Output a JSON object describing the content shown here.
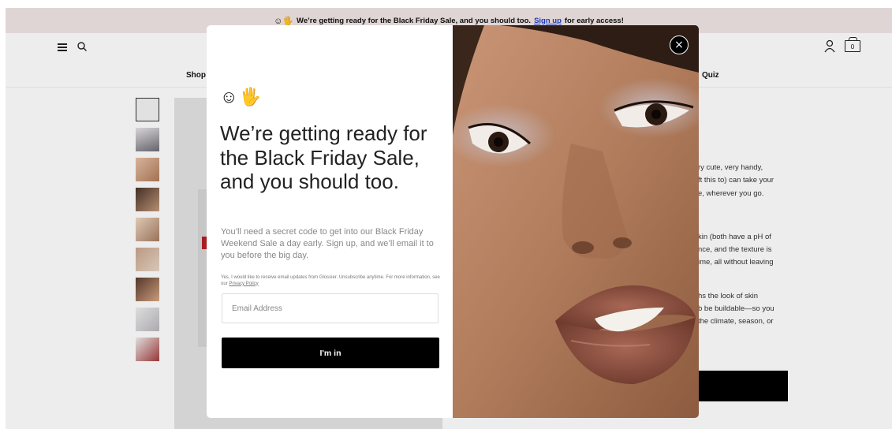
{
  "announcement": {
    "emoji": "☺🖐",
    "text": "We’re getting ready for the Black Friday Sale, and you should too.",
    "link": "Sign up",
    "after": "for early access!"
  },
  "header": {
    "menu_icon": "hamburger-icon",
    "search_icon": "search-icon",
    "account_icon": "user-icon",
    "bag_icon": "bag-icon",
    "bag_count": "0"
  },
  "nav": {
    "shop": "Shop",
    "quiz": "Quiz"
  },
  "product_description": [
    "ry cute, very handy,",
    "ft this to) can take your",
    "e, wherever you go.",
    "kin (both have a pH of",
    "nce, and the texture is",
    "ime, all without leaving",
    "hs the look of skin",
    "b be buildable—so you",
    "the climate, season, or"
  ],
  "modal": {
    "emoji": "☺🖐",
    "title": "We’re getting ready for the Black Friday Sale, and you should too.",
    "subtitle": "You’ll need a secret code to get into our Black Friday Weekend Sale a day early. Sign up, and we’ll email it to you before the big day.",
    "legal": "Yes, I would like to receive email updates from Glossier. Unsubscribe anytime. For more information, see our",
    "privacy_link": "Privacy Policy",
    "email_placeholder": "Email Address",
    "submit_label": "I'm in",
    "close_label": "×"
  },
  "colors": {
    "announcement_bg": "#f1e6e6",
    "link": "#1d3fc7",
    "button": "#000000",
    "sale_accent": "#b32025"
  }
}
